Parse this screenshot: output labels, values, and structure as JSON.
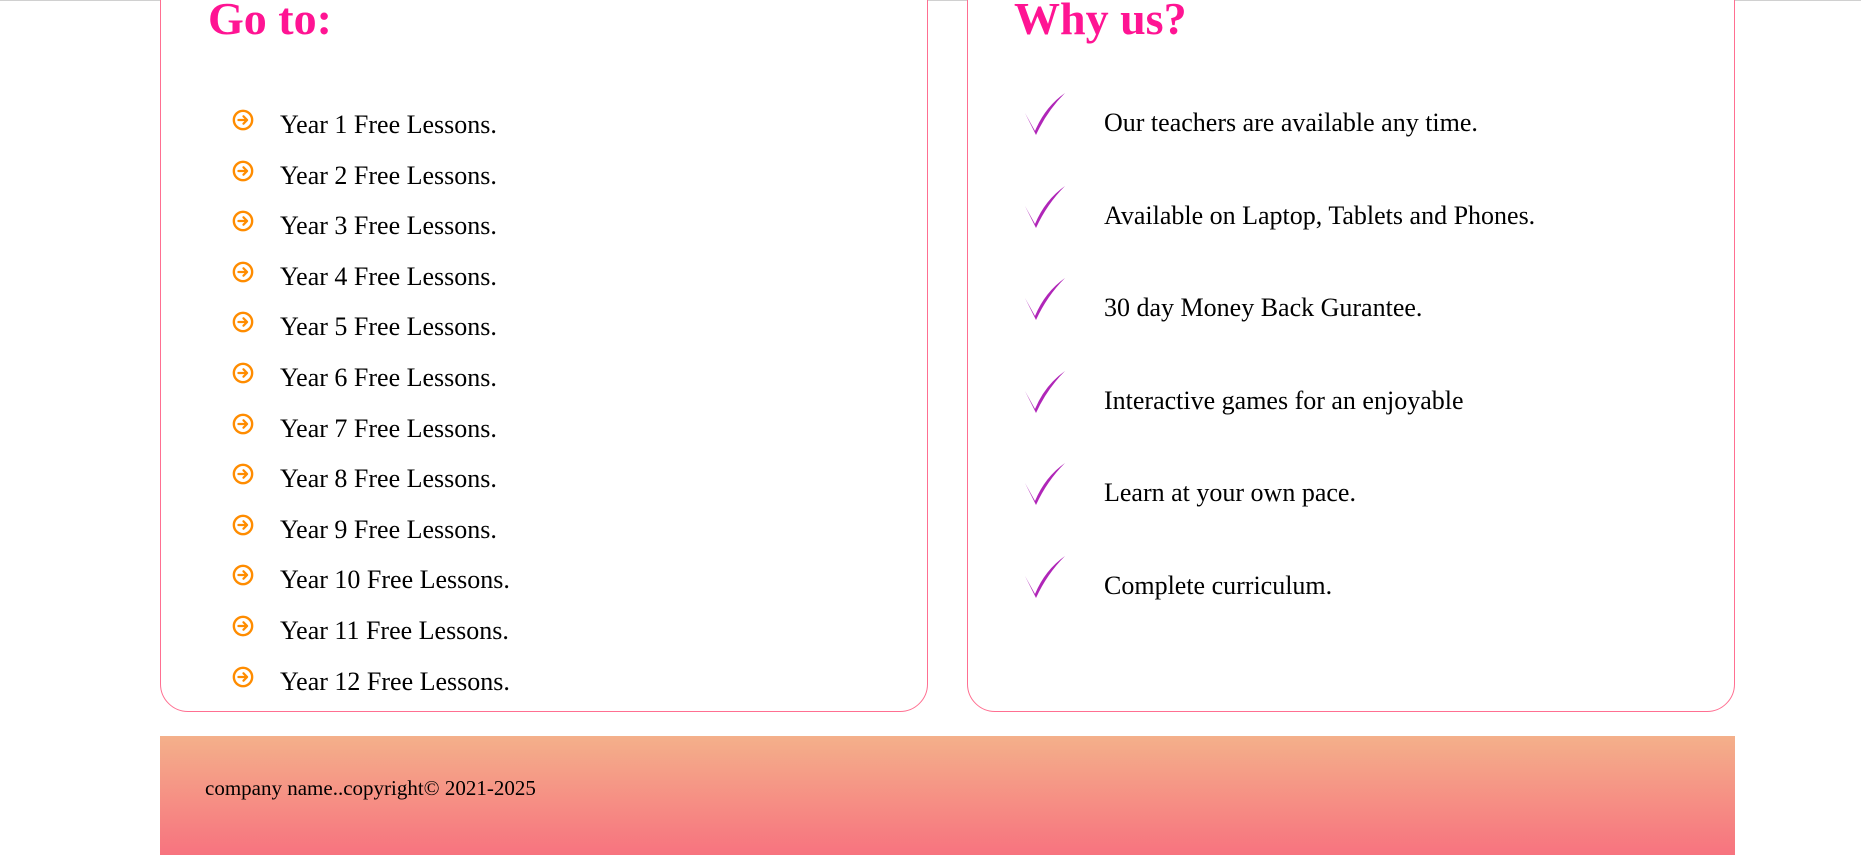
{
  "goto": {
    "title": "Go to:",
    "icon": "arrow-circle-right-icon",
    "icon_color": "#ff8c00",
    "items": [
      "Year 1 Free Lessons.",
      "Year 2 Free Lessons.",
      "Year 3 Free Lessons.",
      "Year 4 Free Lessons.",
      "Year 5 Free Lessons.",
      "Year 6 Free Lessons.",
      "Year 7 Free Lessons.",
      "Year 8 Free Lessons.",
      "Year 9 Free Lessons.",
      "Year 10 Free Lessons.",
      "Year 11 Free Lessons.",
      "Year 12 Free Lessons."
    ]
  },
  "why": {
    "title": "Why us?",
    "icon": "checkmark-icon",
    "icon_color": "#b026b8",
    "items": [
      "Our teachers are available any time.",
      "Available on Laptop, Tablets and Phones.",
      "30 day Money Back Gurantee.",
      "Interactive games for an enjoyable",
      "Learn at your own pace.",
      "Complete curriculum."
    ]
  },
  "footer": {
    "text": "company name..copyright© 2021-2025"
  },
  "colors": {
    "heading": "#ff1493",
    "card_border": "#ff6f91",
    "footer_gradient": [
      "#f4b08a",
      "#f7737f"
    ]
  }
}
